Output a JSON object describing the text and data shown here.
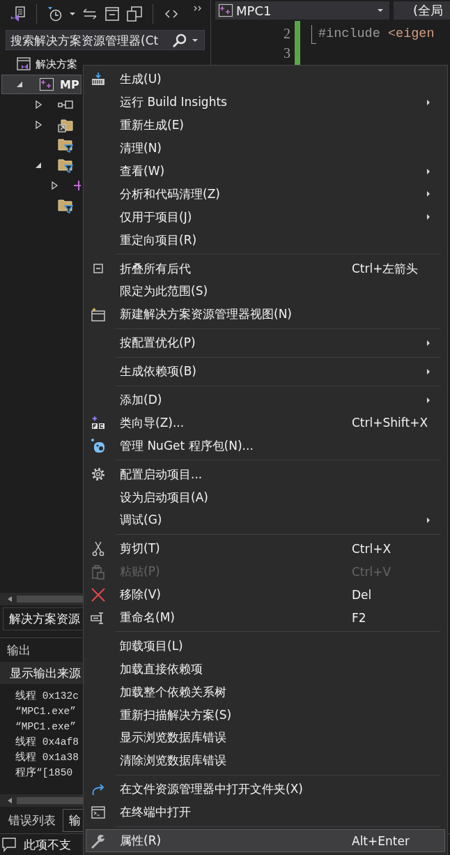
{
  "search": {
    "placeholder": "搜索解决方案资源管理器(Ct"
  },
  "tree": [
    {
      "kind": "solution",
      "label": "解决方案",
      "selected": false,
      "children": [
        {
          "kind": "project",
          "label": "MP",
          "selected": true,
          "expanded": true,
          "children": [
            {
              "kind": "references",
              "selected": false,
              "expanded": false
            },
            {
              "kind": "external",
              "selected": false,
              "expanded": false
            },
            {
              "kind": "filter",
              "selected": false
            },
            {
              "kind": "filter",
              "selected": false,
              "expanded": true,
              "children": [
                {
                  "kind": "file",
                  "selected": false,
                  "expanded": false
                }
              ]
            },
            {
              "kind": "filter",
              "selected": false
            }
          ]
        }
      ]
    }
  ],
  "explorer_tab": "解决方案资源",
  "output": {
    "title": "输出",
    "source_label": "显示输出来源",
    "lines": [
      "线程 0x132c",
      "“MPC1.exe”",
      "“MPC1.exe”",
      "线程 0x4af8",
      "线程 0x1a38",
      "程序“[1850"
    ]
  },
  "bottom_tabs": [
    {
      "label": "错误列表",
      "selected": false
    },
    {
      "label": "输",
      "selected": true
    }
  ],
  "status_bar": {
    "text": "此项不支"
  },
  "editor": {
    "project_dropdown": "MPC1",
    "scope_dropdown": "(全局",
    "lines": [
      {
        "number": "2",
        "tokens": [
          {
            "kind": "directive",
            "text": "#include "
          },
          {
            "kind": "string",
            "text": "<eigen"
          }
        ]
      },
      {
        "number": "3"
      }
    ]
  },
  "menu": {
    "items": [
      {
        "kind": "item",
        "label": "生成(U)",
        "submenu": false,
        "disabled": false,
        "selected": false
      },
      {
        "kind": "item",
        "label": "运行 Build Insights",
        "submenu": true,
        "disabled": false,
        "selected": false
      },
      {
        "kind": "item",
        "label": "重新生成(E)",
        "submenu": false,
        "disabled": false,
        "selected": false
      },
      {
        "kind": "item",
        "label": "清理(N)",
        "submenu": false,
        "disabled": false,
        "selected": false
      },
      {
        "kind": "item",
        "label": "查看(W)",
        "submenu": true,
        "disabled": false,
        "selected": false
      },
      {
        "kind": "item",
        "label": "分析和代码清理(Z)",
        "submenu": true,
        "disabled": false,
        "selected": false
      },
      {
        "kind": "item",
        "label": "仅用于项目(J)",
        "submenu": true,
        "disabled": false,
        "selected": false
      },
      {
        "kind": "item",
        "label": "重定向项目(R)",
        "submenu": false,
        "disabled": false,
        "selected": false
      },
      {
        "kind": "separator"
      },
      {
        "kind": "item",
        "label": "折叠所有后代",
        "shortcut": "Ctrl+左箭头",
        "submenu": false,
        "disabled": false,
        "selected": false
      },
      {
        "kind": "item",
        "label": "限定为此范围(S)",
        "submenu": false,
        "disabled": false,
        "selected": false
      },
      {
        "kind": "item",
        "label": "新建解决方案资源管理器视图(N)",
        "submenu": false,
        "disabled": false,
        "selected": false
      },
      {
        "kind": "separator"
      },
      {
        "kind": "item",
        "label": "按配置优化(P)",
        "submenu": true,
        "disabled": false,
        "selected": false
      },
      {
        "kind": "separator"
      },
      {
        "kind": "item",
        "label": "生成依赖项(B)",
        "submenu": true,
        "disabled": false,
        "selected": false
      },
      {
        "kind": "separator"
      },
      {
        "kind": "item",
        "label": "添加(D)",
        "submenu": true,
        "disabled": false,
        "selected": false
      },
      {
        "kind": "item",
        "label": "类向导(Z)...",
        "shortcut": "Ctrl+Shift+X",
        "submenu": false,
        "disabled": false,
        "selected": false
      },
      {
        "kind": "item",
        "label": "管理 NuGet 程序包(N)...",
        "submenu": false,
        "disabled": false,
        "selected": false
      },
      {
        "kind": "separator"
      },
      {
        "kind": "item",
        "label": "配置启动项目...",
        "submenu": false,
        "disabled": false,
        "selected": false
      },
      {
        "kind": "item",
        "label": "设为启动项目(A)",
        "submenu": false,
        "disabled": false,
        "selected": false
      },
      {
        "kind": "item",
        "label": "调试(G)",
        "submenu": true,
        "disabled": false,
        "selected": false
      },
      {
        "kind": "separator"
      },
      {
        "kind": "item",
        "label": "剪切(T)",
        "shortcut": "Ctrl+X",
        "submenu": false,
        "disabled": false,
        "selected": false
      },
      {
        "kind": "item",
        "label": "粘贴(P)",
        "shortcut": "Ctrl+V",
        "submenu": false,
        "disabled": true,
        "selected": false
      },
      {
        "kind": "item",
        "label": "移除(V)",
        "shortcut": "Del",
        "submenu": false,
        "disabled": false,
        "selected": false
      },
      {
        "kind": "item",
        "label": "重命名(M)",
        "shortcut": "F2",
        "submenu": false,
        "disabled": false,
        "selected": false
      },
      {
        "kind": "separator"
      },
      {
        "kind": "item",
        "label": "卸载项目(L)",
        "submenu": false,
        "disabled": false,
        "selected": false
      },
      {
        "kind": "item",
        "label": "加载直接依赖项",
        "submenu": false,
        "disabled": false,
        "selected": false
      },
      {
        "kind": "item",
        "label": "加载整个依赖关系树",
        "submenu": false,
        "disabled": false,
        "selected": false
      },
      {
        "kind": "item",
        "label": "重新扫描解决方案(S)",
        "submenu": false,
        "disabled": false,
        "selected": false
      },
      {
        "kind": "item",
        "label": "显示浏览数据库错误",
        "submenu": false,
        "disabled": false,
        "selected": false
      },
      {
        "kind": "item",
        "label": "清除浏览数据库错误",
        "submenu": false,
        "disabled": false,
        "selected": false
      },
      {
        "kind": "separator"
      },
      {
        "kind": "item",
        "label": "在文件资源管理器中打开文件夹(X)",
        "submenu": false,
        "disabled": false,
        "selected": false
      },
      {
        "kind": "item",
        "label": "在终端中打开",
        "submenu": false,
        "disabled": false,
        "selected": false
      },
      {
        "kind": "separator"
      },
      {
        "kind": "item",
        "label": "属性(R)",
        "shortcut": "Alt+Enter",
        "submenu": false,
        "disabled": false,
        "selected": true
      }
    ]
  }
}
